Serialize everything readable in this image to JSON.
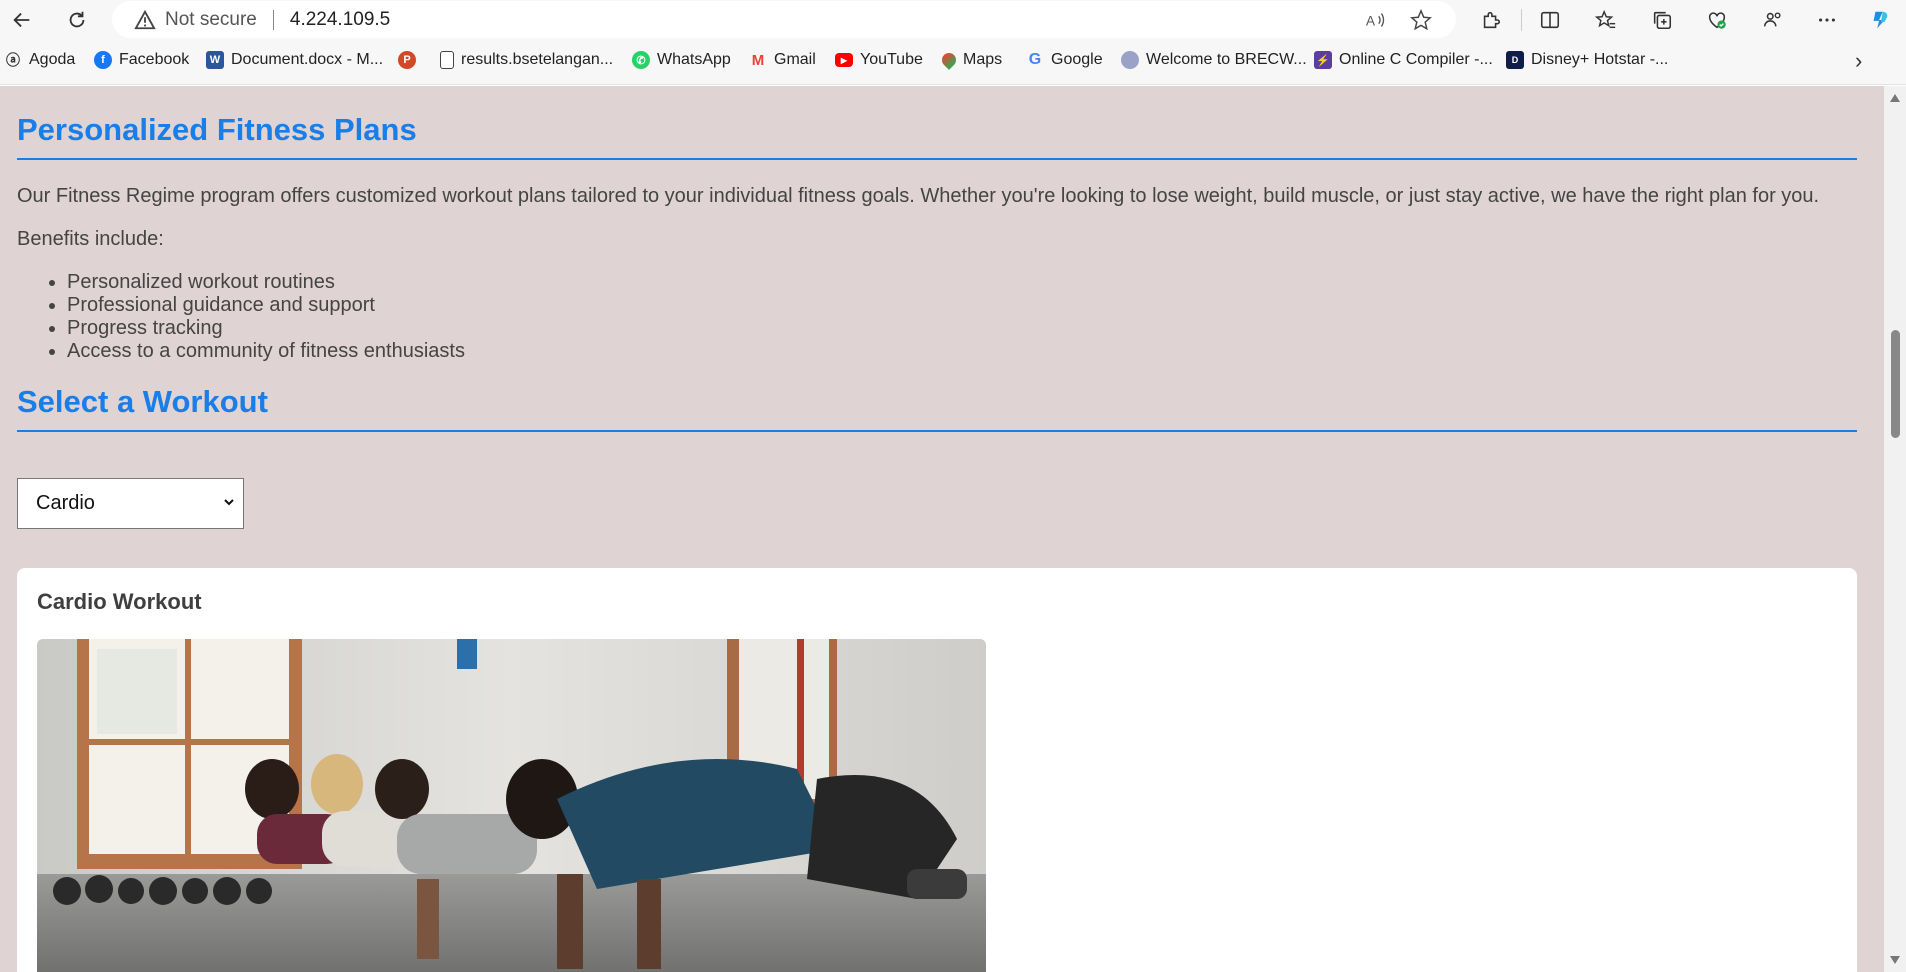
{
  "browser": {
    "security_label": "Not secure",
    "url": "4.224.109.5"
  },
  "bookmarks": [
    {
      "label": "Agoda",
      "icon": "agoda-icon"
    },
    {
      "label": "Facebook",
      "icon": "facebook-icon"
    },
    {
      "label": "Document.docx - M...",
      "icon": "word-icon"
    },
    {
      "label": "",
      "icon": "powerpoint-icon"
    },
    {
      "label": "results.bsetelangan...",
      "icon": "page-icon"
    },
    {
      "label": "WhatsApp",
      "icon": "whatsapp-icon"
    },
    {
      "label": "Gmail",
      "icon": "gmail-icon"
    },
    {
      "label": "YouTube",
      "icon": "youtube-icon"
    },
    {
      "label": "Maps",
      "icon": "maps-icon"
    },
    {
      "label": "Google",
      "icon": "google-icon"
    },
    {
      "label": "Welcome to BRECW...",
      "icon": "shield-icon"
    },
    {
      "label": "Online C Compiler -...",
      "icon": "compiler-icon"
    },
    {
      "label": "Disney+ Hotstar -...",
      "icon": "hotstar-icon"
    }
  ],
  "page": {
    "section1_title": "Personalized Fitness Plans",
    "intro": "Our Fitness Regime program offers customized workout plans tailored to your individual fitness goals. Whether you're looking to lose weight, build muscle, or just stay active, we have the right plan for you.",
    "benefits_label": "Benefits include:",
    "benefits": [
      "Personalized workout routines",
      "Professional guidance and support",
      "Progress tracking",
      "Access to a community of fitness enthusiasts"
    ],
    "section2_title": "Select a Workout",
    "workout_select": {
      "selected": "Cardio"
    },
    "card_title": "Cardio Workout"
  },
  "colors": {
    "accent": "#1a7ee8",
    "page_bg": "#e0d3d3"
  }
}
